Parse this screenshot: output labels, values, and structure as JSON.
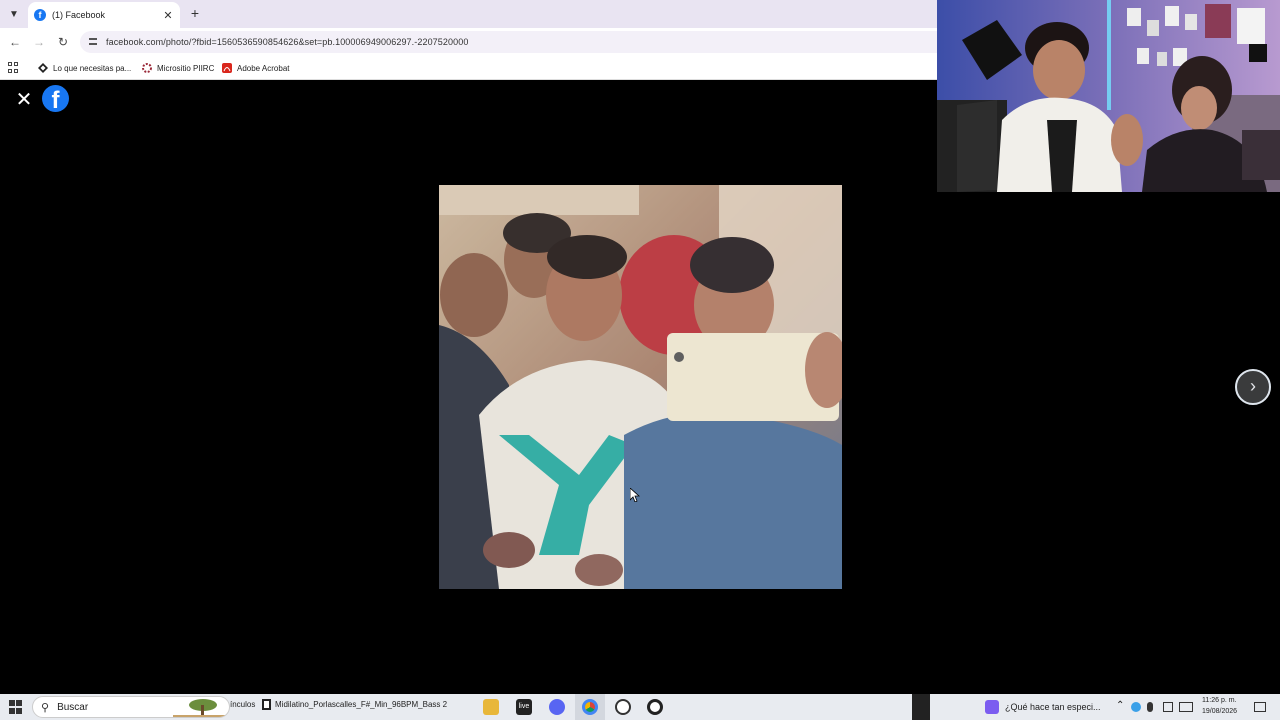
{
  "browser": {
    "tab": {
      "title": "(1) Facebook",
      "favicon": "f"
    },
    "url": "facebook.com/photo/?fbid=1560536590854626&set=pb.100006949006297.-2207520000",
    "bookmarks": [
      {
        "label": "Lo que necesitas pa...",
        "icon": "diamond-icon"
      },
      {
        "label": "Micrositio PIIRC",
        "icon": "micrositio-icon"
      },
      {
        "label": "Adobe Acrobat",
        "icon": "acrobat-icon"
      }
    ]
  },
  "viewer": {
    "logo": "f",
    "close_glyph": "✕",
    "next_glyph": "›"
  },
  "taskbar": {
    "search_placeholder": "Buscar",
    "vinculos_label": "ínculos",
    "window_label": "Midilatino_Porlascalles_F#_Min_96BPM_Bass 2",
    "live_label": "live",
    "copilot_label": "¿Qué hace tan especi...",
    "time": "11:26 p. m.",
    "date": "19/08/2026"
  },
  "colors": {
    "facebook_blue": "#1877f2",
    "tabbar": "#e9e4f2",
    "taskbar": "#e8ebf0"
  }
}
